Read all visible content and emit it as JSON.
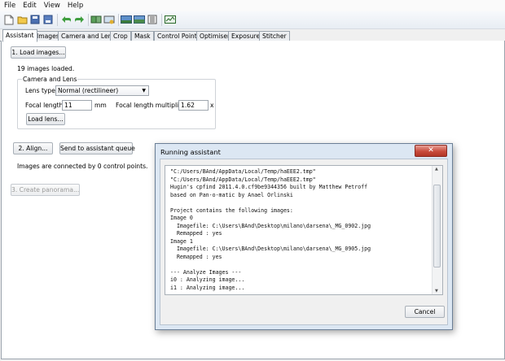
{
  "menu": [
    "File",
    "Edit",
    "View",
    "Help"
  ],
  "toolbar": {
    "icons": [
      "new-project-icon",
      "open-project-icon",
      "save-project-icon",
      "undo-icon",
      "redo-icon",
      "control-points-icon",
      "optimize-icon",
      "preview-icon",
      "fast-preview-icon",
      "layout-icon",
      "panorama-preview-icon"
    ]
  },
  "tabs": [
    "Assistant",
    "Images",
    "Camera and Lens",
    "Crop",
    "Mask",
    "Control Points",
    "Optimiser",
    "Exposure",
    "Stitcher"
  ],
  "assistant": {
    "load_images": "1. Load images...",
    "images_loaded": "19 images loaded.",
    "camera_group": "Camera and Lens",
    "lens_type_label": "Lens type:",
    "lens_type_value": "Normal (rectilineer)",
    "focal_length_label": "Focal length:",
    "focal_length_value": "11",
    "focal_length_unit": "mm",
    "multiplier_label": "Focal length multiplier:",
    "multiplier_value": "1.62",
    "multiplier_unit": "x",
    "load_lens": "Load lens...",
    "align": "2. Align...",
    "send_queue": "Send to assistant queue",
    "status": "Images are connected by 0 control points.",
    "create_panorama": "3. Create panorama..."
  },
  "dialog": {
    "title": "Running assistant",
    "close": "✕",
    "log": "\"C:/Users/BAnd/AppData/Local/Temp/haEEE2.tmp\"\n\"C:/Users/BAnd/AppData/Local/Temp/haEEE2.tmp\"\nHugin's cpfind 2011.4.0.cf9be9344356 built by Matthew Petroff\nbased on Pan-o-matic by Anael Orlinski\n\nProject contains the following images:\nImage 0\n  Imagefile: C:\\Users\\BAnd\\Desktop\\milano\\darsena\\_MG_0902.jpg\n  Remapped : yes\nImage 1\n  Imagefile: C:\\Users\\BAnd\\Desktop\\milano\\darsena\\_MG_0905.jpg\n  Remapped : yes\n\n--- Analyze Images ---\ni0 : Analyzing image...\ni1 : Analyzing image...",
    "cancel": "Cancel"
  },
  "colors": {
    "dialog_frame": "#dce7f3",
    "close_button": "#c84b3c",
    "tab_border": "#9aa3ad"
  }
}
